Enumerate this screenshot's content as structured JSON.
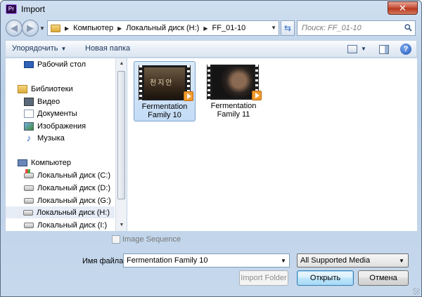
{
  "window": {
    "title": "Import",
    "app_icon": "Pr",
    "close_glyph": "✕"
  },
  "address": {
    "crumbs": [
      "Компьютер",
      "Локальный диск (H:)",
      "FF_01-10"
    ],
    "search_placeholder": "Поиск: FF_01-10"
  },
  "toolbar": {
    "organize_label": "Упорядочить",
    "new_folder_label": "Новая папка",
    "help_glyph": "?"
  },
  "sidebar": {
    "items": [
      {
        "label": "Рабочий стол",
        "icon": "desktop-icon"
      },
      {
        "label": "Библиотеки",
        "icon": "library-icon"
      },
      {
        "label": "Видео",
        "icon": "video-library-icon"
      },
      {
        "label": "Документы",
        "icon": "documents-icon"
      },
      {
        "label": "Изображения",
        "icon": "pictures-icon"
      },
      {
        "label": "Музыка",
        "icon": "music-icon"
      },
      {
        "label": "Компьютер",
        "icon": "computer-icon"
      },
      {
        "label": "Локальный диск (C:)",
        "icon": "system-drive-icon"
      },
      {
        "label": "Локальный диск (D:)",
        "icon": "drive-icon"
      },
      {
        "label": "Локальный диск (G:)",
        "icon": "drive-icon"
      },
      {
        "label": "Локальный диск (H:)",
        "icon": "drive-icon",
        "selected": true
      },
      {
        "label": "Локальный диск (I:)",
        "icon": "drive-icon"
      }
    ]
  },
  "files": [
    {
      "name_line1": "Fermentation",
      "name_line2": "Family 10",
      "selected": true,
      "thumb_text": "천지안"
    },
    {
      "name_line1": "Fermentation",
      "name_line2": "Family 11",
      "selected": false
    }
  ],
  "options": {
    "image_sequence_label": "Image Sequence",
    "image_sequence_checked": false
  },
  "footer": {
    "filename_label": "Имя файла:",
    "filename_value": "Fermentation Family 10",
    "filetype_value": "All Supported Media",
    "import_folder_label": "Import Folder",
    "open_label": "Открыть",
    "cancel_label": "Отмена"
  },
  "colors": {
    "frame": "#b9cfe7",
    "selection": "#c4dcf6",
    "accent": "#3c7fb1",
    "close": "#c8523b"
  }
}
